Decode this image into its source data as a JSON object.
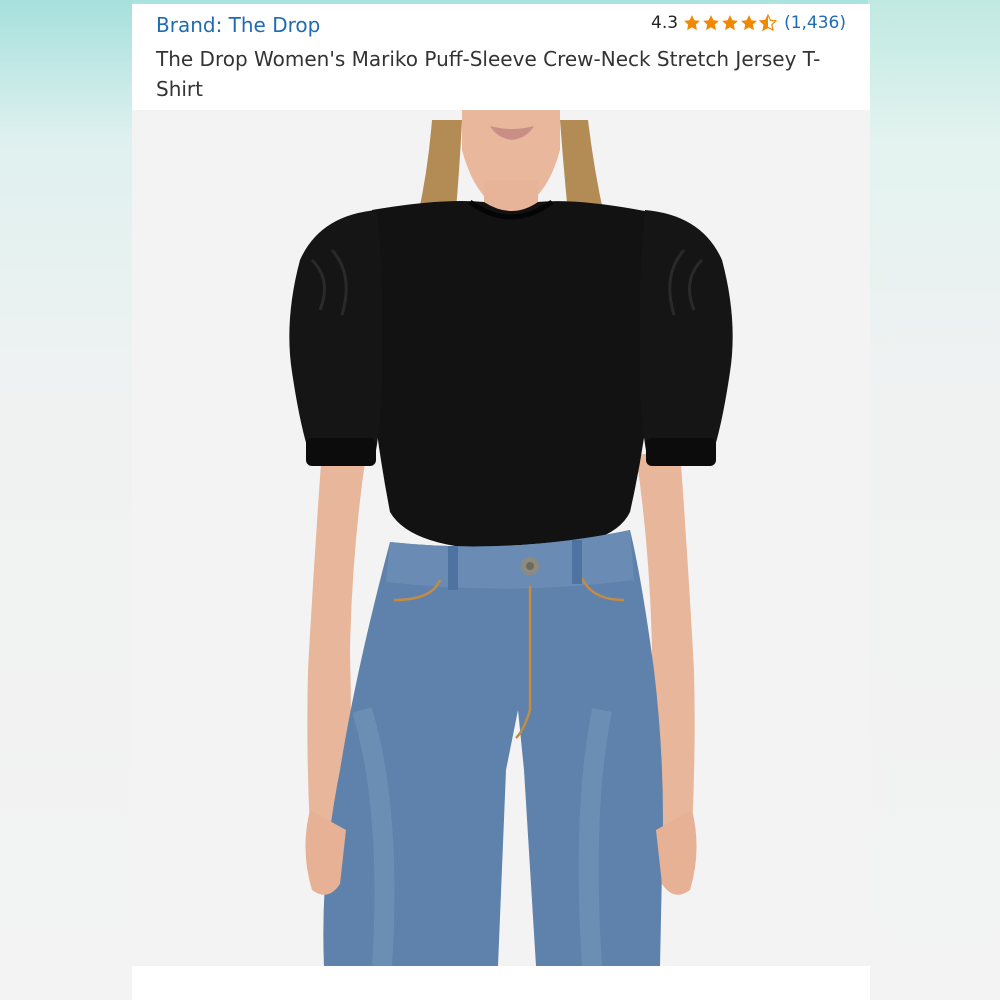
{
  "listing": {
    "brand_label": "Brand: The Drop",
    "rating_value": "4.3",
    "rating_stars": 4.3,
    "review_count": "(1,436)",
    "title": "The Drop Women's Mariko Puff-Sleeve Crew-Neck Stretch Jersey T-Shirt"
  },
  "colors": {
    "link": "#1f6bb5",
    "star": "#f08804",
    "shirt": "#121212",
    "denim": "#5e82ab"
  },
  "icons": {
    "star": "star-icon",
    "half_star": "half-star-icon"
  }
}
